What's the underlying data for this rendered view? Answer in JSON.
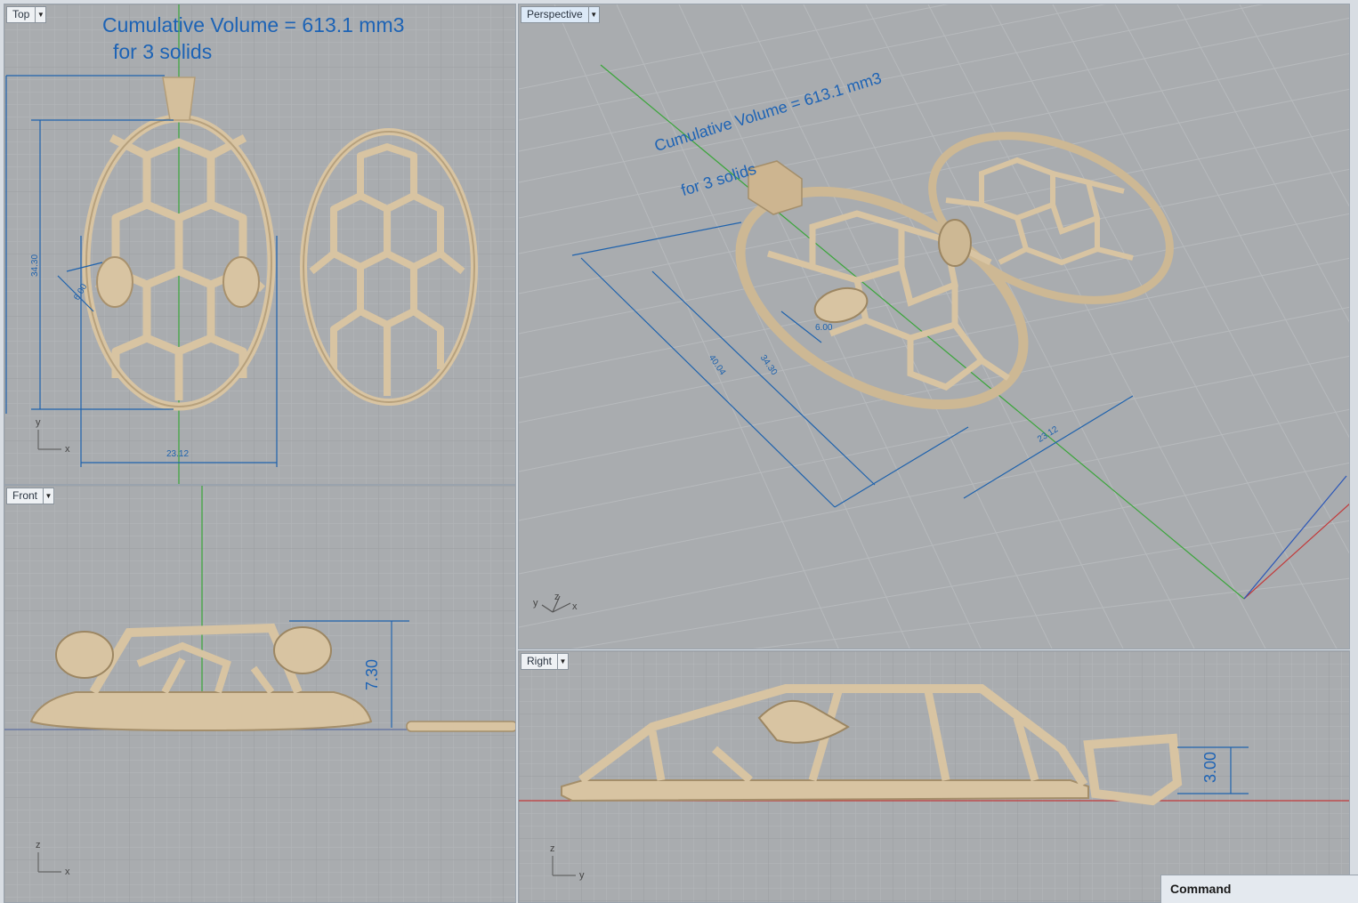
{
  "viewports": {
    "top": {
      "label": "Top",
      "volume_line1": "Cumulative Volume = 613.1 mm3",
      "volume_line2": "for 3 solids",
      "dim_height": "34.30",
      "dim_width": "23.12",
      "dim_small": "6.00",
      "axis_x": "x",
      "axis_y": "y"
    },
    "perspective": {
      "label": "Perspective",
      "volume_line1": "Cumulative Volume = 613.1 mm3",
      "volume_line2": "for 3 solids",
      "dim_outer": "40.04",
      "dim_inner": "34.30",
      "dim_small": "6.00",
      "dim_width": "23.12",
      "axis_x": "x",
      "axis_y": "y",
      "axis_z": "z"
    },
    "front": {
      "label": "Front",
      "dim_height": "7.30",
      "axis_x": "x",
      "axis_z": "z"
    },
    "right": {
      "label": "Right",
      "dim_height": "3.00",
      "axis_y": "y",
      "axis_z": "z"
    }
  },
  "command": {
    "label": "Command"
  },
  "colors": {
    "viewport_bg": "#a9acaf",
    "grid_minor": "#b4b7ba",
    "grid_major": "#9d9fa2",
    "model_gold": "#d8c4a2",
    "dimension_blue": "#1e62ad",
    "y_axis_green": "#3aa53a",
    "x_axis_red": "#c23a3a"
  }
}
